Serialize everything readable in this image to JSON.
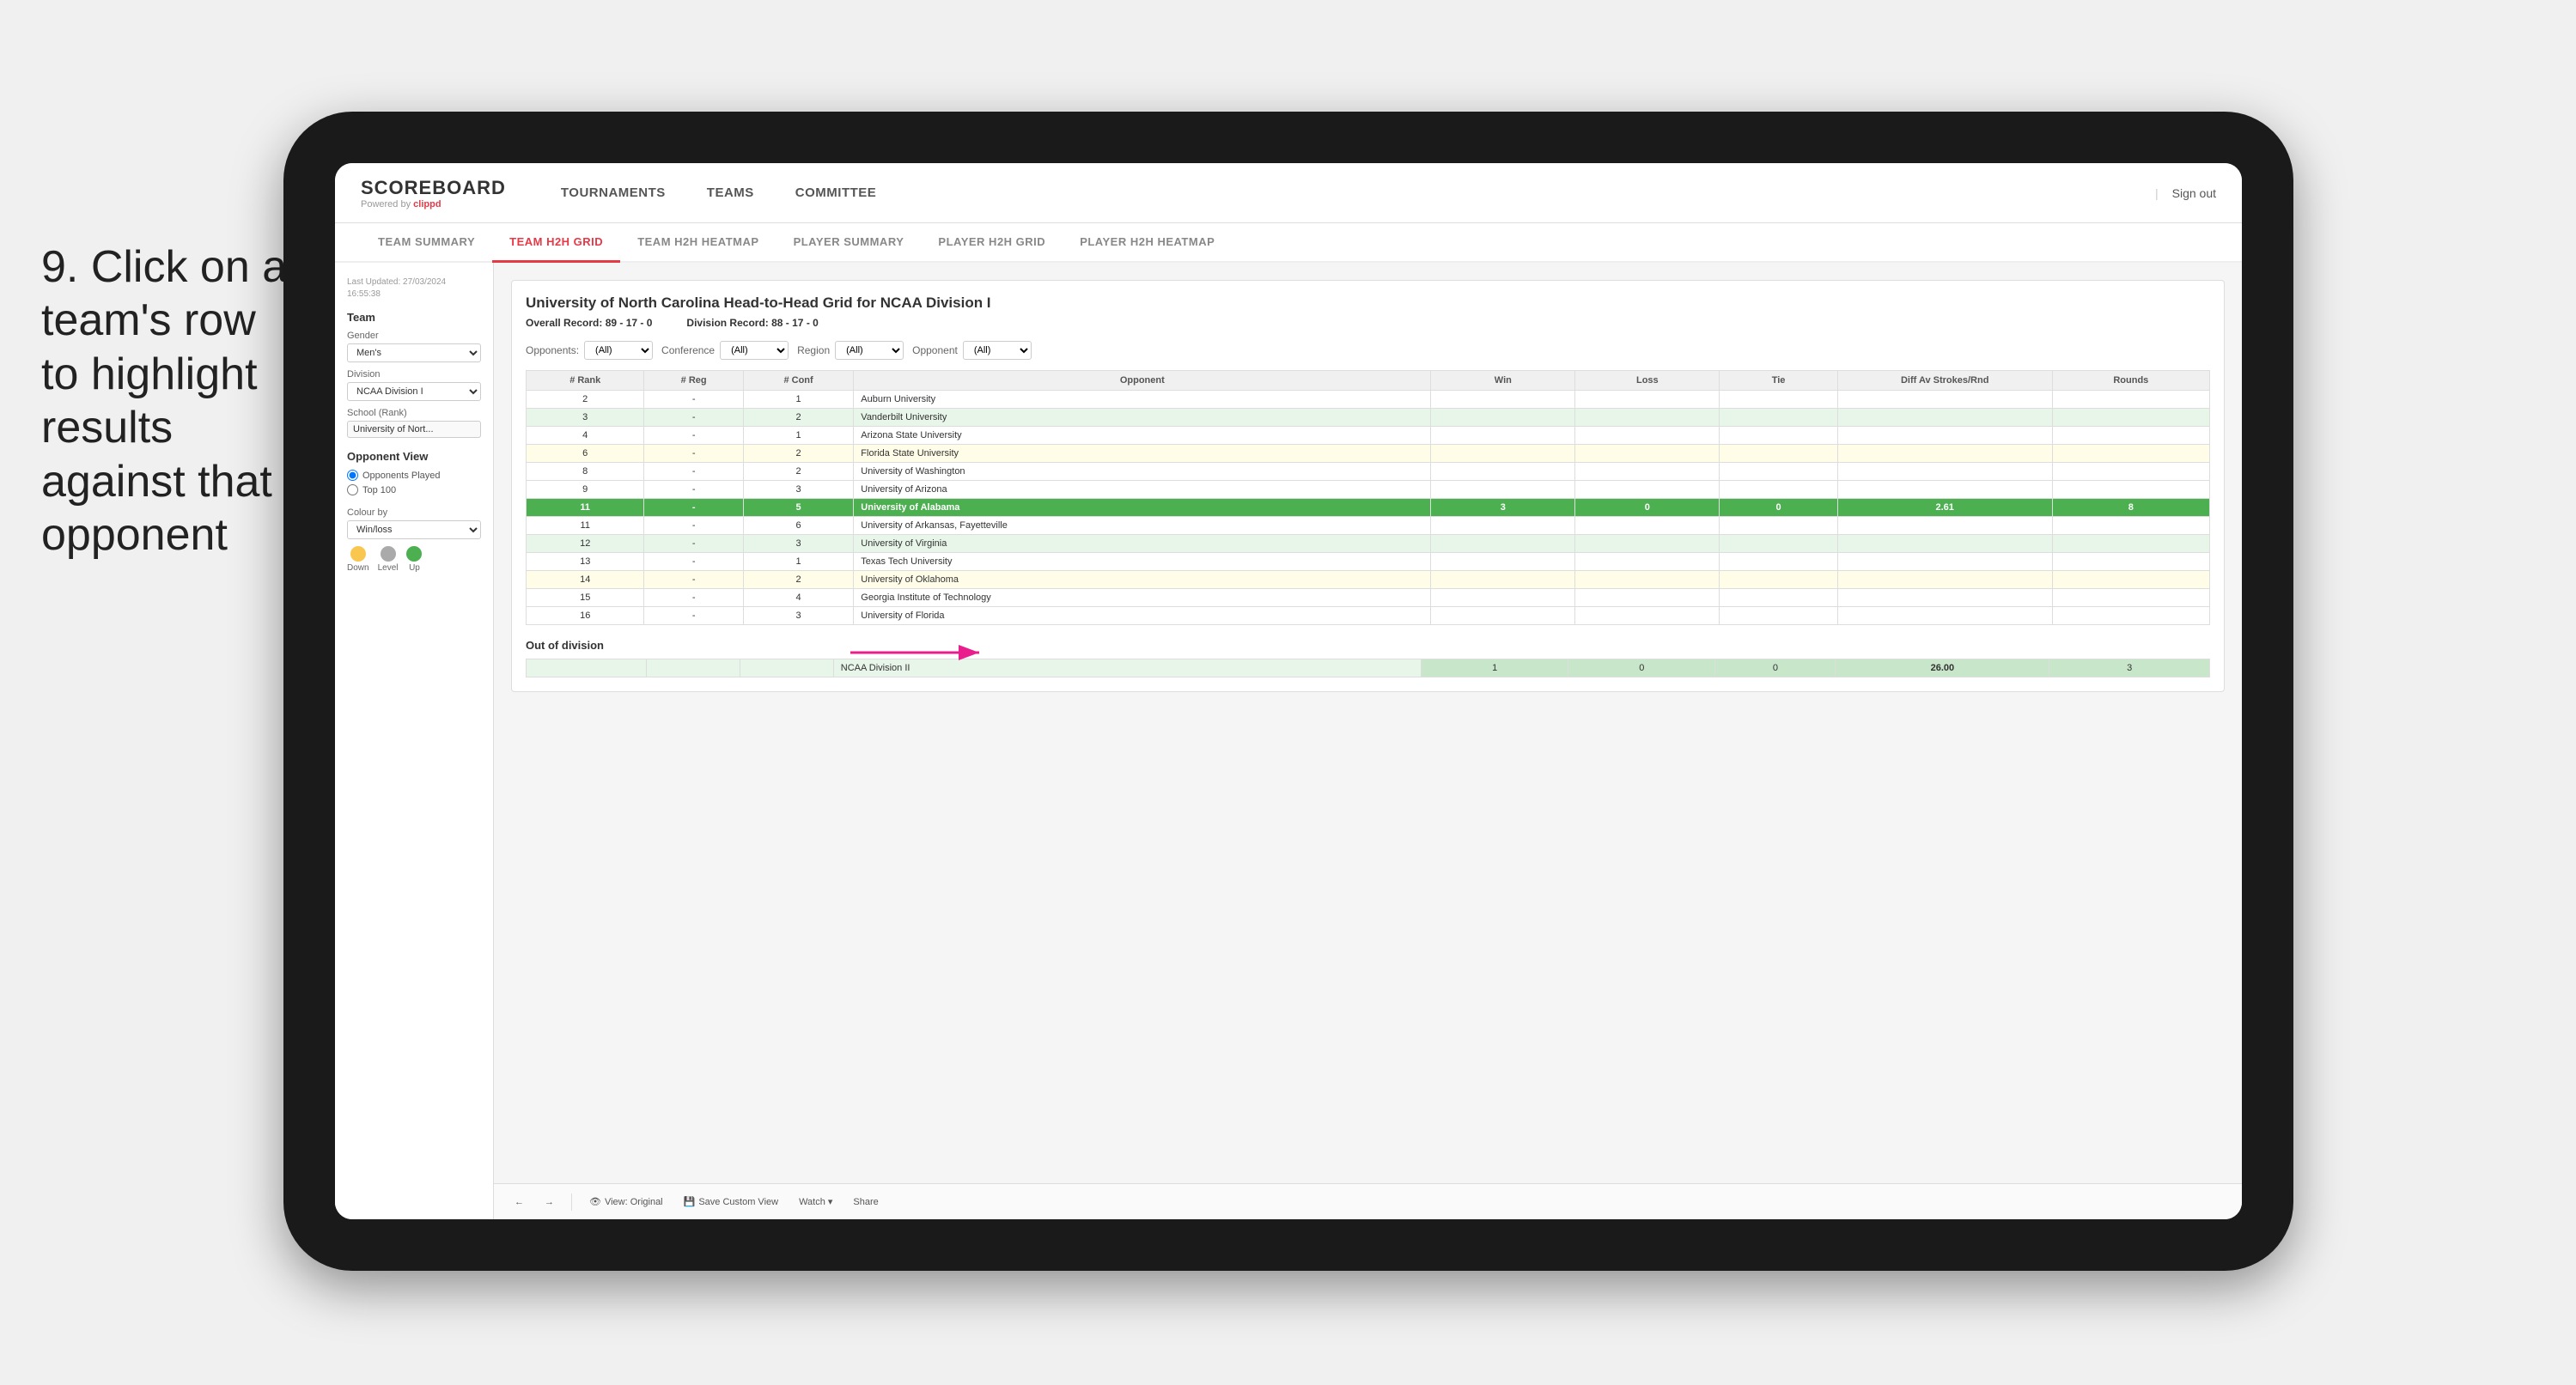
{
  "instruction": {
    "step_number": "9.",
    "text": "Click on a team's row to highlight results against that opponent"
  },
  "tablet": {
    "app": {
      "logo": {
        "name": "SCOREBOARD",
        "powered_by": "Powered by",
        "brand": "clippd"
      },
      "nav": {
        "items": [
          "TOURNAMENTS",
          "TEAMS",
          "COMMITTEE"
        ],
        "sign_out": "Sign out"
      },
      "sub_nav": {
        "items": [
          "TEAM SUMMARY",
          "TEAM H2H GRID",
          "TEAM H2H HEATMAP",
          "PLAYER SUMMARY",
          "PLAYER H2H GRID",
          "PLAYER H2H HEATMAP"
        ],
        "active": "TEAM H2H GRID"
      }
    },
    "sidebar": {
      "last_updated_label": "Last Updated: 27/03/2024",
      "time": "16:55:38",
      "team_label": "Team",
      "gender_label": "Gender",
      "gender_value": "Men's",
      "division_label": "Division",
      "division_value": "NCAA Division I",
      "school_rank_label": "School (Rank)",
      "school_rank_value": "University of Nort...",
      "opponent_view_label": "Opponent View",
      "opponents_played": "Opponents Played",
      "top_100": "Top 100",
      "colour_by_label": "Colour by",
      "colour_by_value": "Win/loss",
      "legend": [
        {
          "label": "Down",
          "color": "#f9c74f"
        },
        {
          "label": "Level",
          "color": "#aaaaaa"
        },
        {
          "label": "Up",
          "color": "#4caf50"
        }
      ]
    },
    "grid": {
      "title": "University of North Carolina Head-to-Head Grid for NCAA Division I",
      "overall_record_label": "Overall Record:",
      "overall_record": "89 - 17 - 0",
      "division_record_label": "Division Record:",
      "division_record": "88 - 17 - 0",
      "filters": {
        "opponents_label": "Opponents:",
        "opponents_value": "(All)",
        "conference_label": "Conference",
        "conference_value": "(All)",
        "region_label": "Region",
        "region_value": "(All)",
        "opponent_label": "Opponent",
        "opponent_value": "(All)"
      },
      "table_headers": {
        "rank": "# Rank",
        "reg": "# Reg",
        "conf": "# Conf",
        "opponent": "Opponent",
        "win": "Win",
        "loss": "Loss",
        "tie": "Tie",
        "diff_av": "Diff Av Strokes/Rnd",
        "rounds": "Rounds"
      },
      "rows": [
        {
          "rank": "2",
          "reg": "-",
          "conf": "1",
          "opponent": "Auburn University",
          "win": "",
          "loss": "",
          "tie": "",
          "diff": "",
          "rounds": "",
          "style": "plain"
        },
        {
          "rank": "3",
          "reg": "-",
          "conf": "2",
          "opponent": "Vanderbilt University",
          "win": "",
          "loss": "",
          "tie": "",
          "diff": "",
          "rounds": "",
          "style": "light-green"
        },
        {
          "rank": "4",
          "reg": "-",
          "conf": "1",
          "opponent": "Arizona State University",
          "win": "",
          "loss": "",
          "tie": "",
          "diff": "",
          "rounds": "",
          "style": "plain"
        },
        {
          "rank": "6",
          "reg": "-",
          "conf": "2",
          "opponent": "Florida State University",
          "win": "",
          "loss": "",
          "tie": "",
          "diff": "",
          "rounds": "",
          "style": "light-yellow"
        },
        {
          "rank": "8",
          "reg": "-",
          "conf": "2",
          "opponent": "University of Washington",
          "win": "",
          "loss": "",
          "tie": "",
          "diff": "",
          "rounds": "",
          "style": "plain"
        },
        {
          "rank": "9",
          "reg": "-",
          "conf": "3",
          "opponent": "University of Arizona",
          "win": "",
          "loss": "",
          "tie": "",
          "diff": "",
          "rounds": "",
          "style": "plain"
        },
        {
          "rank": "11",
          "reg": "-",
          "conf": "5",
          "opponent": "University of Alabama",
          "win": "3",
          "loss": "0",
          "tie": "0",
          "diff": "2.61",
          "rounds": "8",
          "style": "highlighted"
        },
        {
          "rank": "11",
          "reg": "-",
          "conf": "6",
          "opponent": "University of Arkansas, Fayetteville",
          "win": "",
          "loss": "",
          "tie": "",
          "diff": "",
          "rounds": "",
          "style": "plain"
        },
        {
          "rank": "12",
          "reg": "-",
          "conf": "3",
          "opponent": "University of Virginia",
          "win": "",
          "loss": "",
          "tie": "",
          "diff": "",
          "rounds": "",
          "style": "light-green"
        },
        {
          "rank": "13",
          "reg": "-",
          "conf": "1",
          "opponent": "Texas Tech University",
          "win": "",
          "loss": "",
          "tie": "",
          "diff": "",
          "rounds": "",
          "style": "plain"
        },
        {
          "rank": "14",
          "reg": "-",
          "conf": "2",
          "opponent": "University of Oklahoma",
          "win": "",
          "loss": "",
          "tie": "",
          "diff": "",
          "rounds": "",
          "style": "light-yellow"
        },
        {
          "rank": "15",
          "reg": "-",
          "conf": "4",
          "opponent": "Georgia Institute of Technology",
          "win": "",
          "loss": "",
          "tie": "",
          "diff": "",
          "rounds": "",
          "style": "plain"
        },
        {
          "rank": "16",
          "reg": "-",
          "conf": "3",
          "opponent": "University of Florida",
          "win": "",
          "loss": "",
          "tie": "",
          "diff": "",
          "rounds": "",
          "style": "plain"
        }
      ],
      "out_of_division_label": "Out of division",
      "out_of_division_row": {
        "label": "NCAA Division II",
        "win": "1",
        "loss": "0",
        "tie": "0",
        "diff": "26.00",
        "rounds": "3"
      }
    },
    "toolbar": {
      "buttons": [
        "View: Original",
        "Save Custom View",
        "Watch ▾",
        "Share"
      ]
    }
  }
}
